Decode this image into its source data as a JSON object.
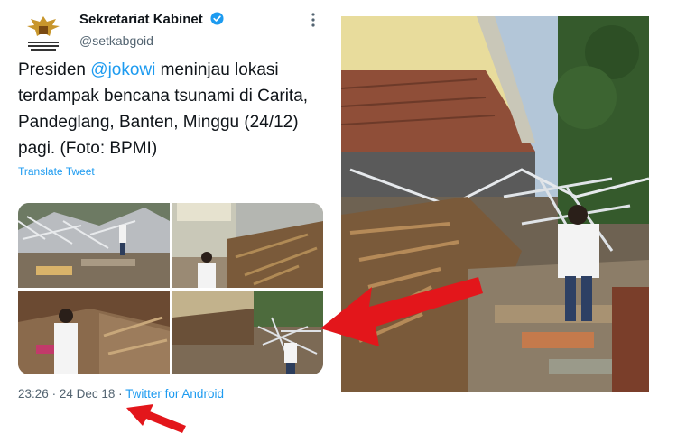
{
  "tweet": {
    "account_name": "Sekretariat Kabinet",
    "handle": "@setkabgoid",
    "avatar_caption": "SEKRETARIAT KABINET REPUBLIK INDONESIA",
    "text_before": "Presiden ",
    "mention": "@jokowi",
    "text_after": " meninjau lokasi terdampak bencana tsunami di Carita, Pandeglang, Banten, Minggu (24/12) pagi. (Foto: BPMI)",
    "translate_label": "Translate Tweet",
    "time": "23:26",
    "separator": "·",
    "date": "24 Dec 18",
    "client": "Twitter for Android"
  },
  "colors": {
    "accent": "#1d9bf0",
    "text": "#0f1419",
    "muted": "#536471",
    "arrow": "#e3161b"
  },
  "icons": {
    "verified": "verified-badge-icon",
    "more": "more-dots-icon",
    "arrows": "red-arrow-icon"
  }
}
